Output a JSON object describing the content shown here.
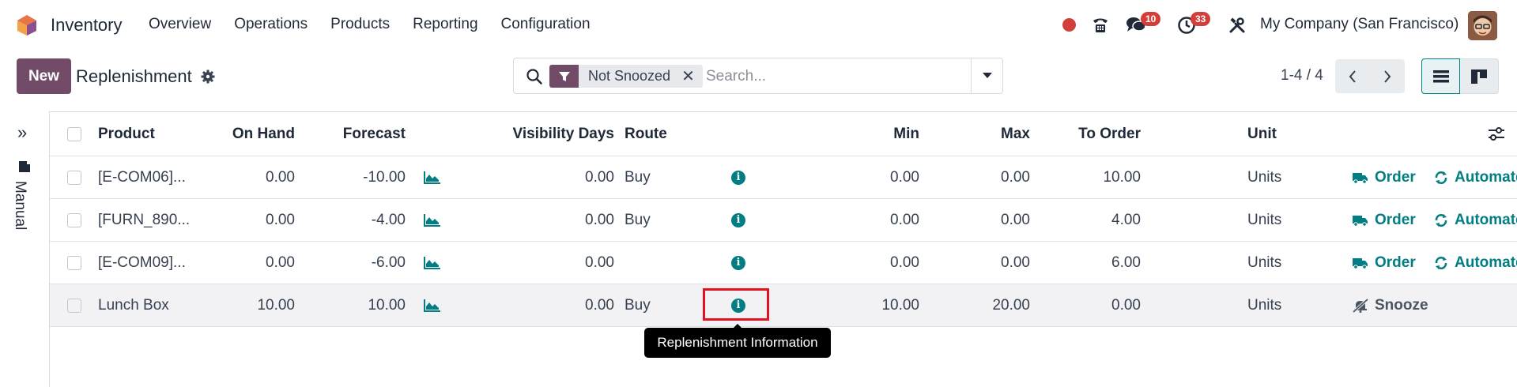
{
  "navbar": {
    "app_name": "Inventory",
    "menu": [
      "Overview",
      "Operations",
      "Products",
      "Reporting",
      "Configuration"
    ],
    "messages_count": "10",
    "activities_count": "33",
    "company": "My Company (San Francisco)"
  },
  "control_panel": {
    "new_label": "New",
    "title": "Replenishment",
    "search": {
      "facet": "Not Snoozed",
      "placeholder": "Search..."
    },
    "pager": "1-4 / 4"
  },
  "side_panel": {
    "label": "Manual"
  },
  "table": {
    "headers": {
      "product": "Product",
      "on_hand": "On Hand",
      "forecast": "Forecast",
      "visibility_days": "Visibility Days",
      "route": "Route",
      "min": "Min",
      "max": "Max",
      "to_order": "To Order",
      "unit": "Unit"
    },
    "rows": [
      {
        "product": "[E-COM06]...",
        "on_hand": "0.00",
        "forecast": "-10.00",
        "visibility_days": "0.00",
        "route": "Buy",
        "min": "0.00",
        "max": "0.00",
        "to_order": "10.00",
        "unit": "Units",
        "order_label": "Order",
        "automate_label": "Automate"
      },
      {
        "product": "[FURN_890...",
        "on_hand": "0.00",
        "forecast": "-4.00",
        "visibility_days": "0.00",
        "route": "Buy",
        "min": "0.00",
        "max": "0.00",
        "to_order": "4.00",
        "unit": "Units",
        "order_label": "Order",
        "automate_label": "Automate"
      },
      {
        "product": "[E-COM09]...",
        "on_hand": "0.00",
        "forecast": "-6.00",
        "visibility_days": "0.00",
        "route": "",
        "min": "0.00",
        "max": "0.00",
        "to_order": "6.00",
        "unit": "Units",
        "order_label": "Order",
        "automate_label": "Automate"
      },
      {
        "product": "Lunch Box",
        "on_hand": "10.00",
        "forecast": "10.00",
        "visibility_days": "0.00",
        "route": "Buy",
        "min": "10.00",
        "max": "20.00",
        "to_order": "0.00",
        "unit": "Units",
        "snooze_label": "Snooze"
      }
    ]
  },
  "tooltip": "Replenishment Information",
  "colors": {
    "brand": "#714b67",
    "accent": "#017e84",
    "highlight": "#e0141e"
  }
}
